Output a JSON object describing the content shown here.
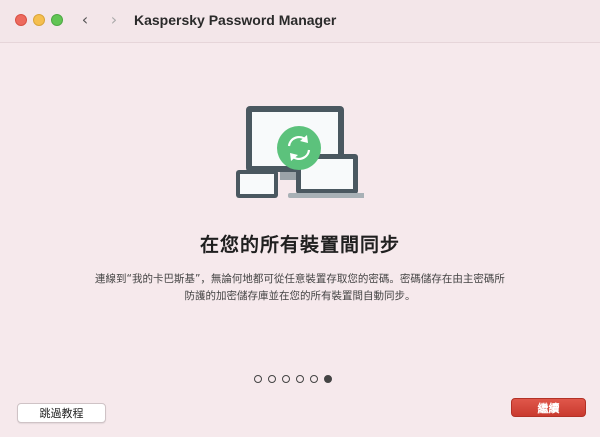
{
  "window": {
    "title": "Kaspersky Password Manager",
    "controls": [
      "close",
      "minimize",
      "zoom"
    ]
  },
  "nav": {
    "back_icon": "chevron-left-icon",
    "forward_icon": "chevron-right-icon"
  },
  "illustration": {
    "icon": "devices-sync-icon",
    "accent_color": "#4caf6a"
  },
  "content": {
    "headline": "在您的所有裝置間同步",
    "description_line1": "連線到“我的卡巴斯基”，無論何地都可從任意裝置存取您的密碼。密碼儲存在由主密碼所",
    "description_line2": "防護的加密儲存庫並在您的所有裝置間自動同步。"
  },
  "pagination": {
    "total": 6,
    "current": 6
  },
  "buttons": {
    "skip_label": "跳過教程",
    "continue_label": "繼續"
  },
  "colors": {
    "background": "#f6e9ec",
    "primary_button": "#d2463a"
  }
}
